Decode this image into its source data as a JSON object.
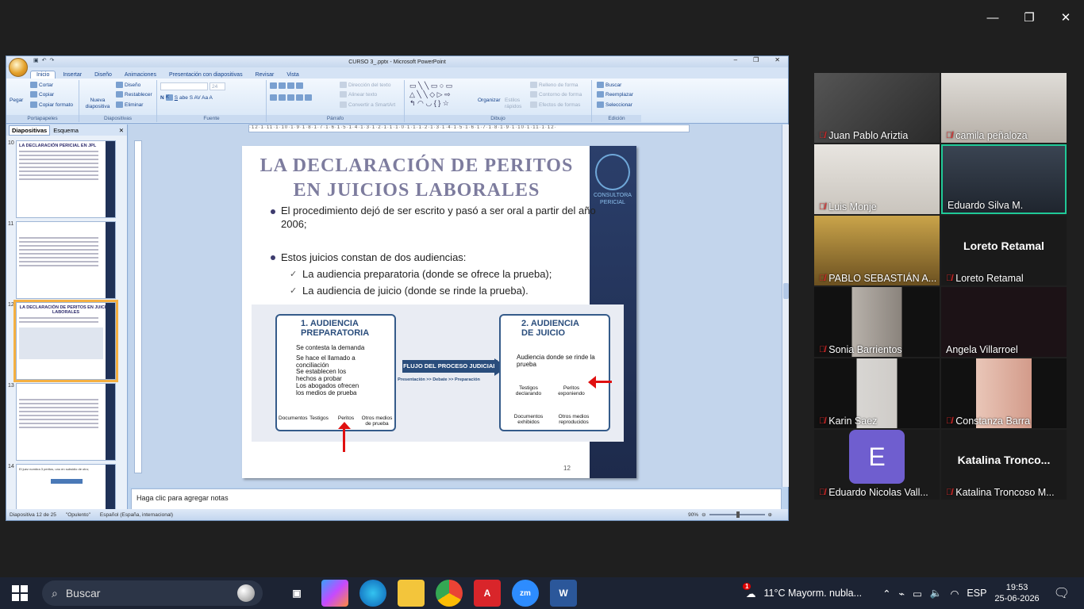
{
  "ppt": {
    "title": "CURSO 3_.pptx - Microsoft PowerPoint",
    "tabs": [
      "Inicio",
      "Insertar",
      "Diseño",
      "Animaciones",
      "Presentación con diapositivas",
      "Revisar",
      "Vista"
    ],
    "ribbon": {
      "pegar": "Pegar",
      "cortar": "Cortar",
      "copiar": "Copiar",
      "copiar_formato": "Copiar formato",
      "nueva_diapositiva": "Nueva diapositiva",
      "diseno": "Diseño",
      "restablecer": "Restablecer",
      "eliminar": "Eliminar",
      "font_size": "24",
      "direccion_texto": "Dirección del texto",
      "alinear_texto": "Alinear texto",
      "convertir_smartart": "Convertir a SmartArt",
      "organizar": "Organizar",
      "estilos_rapidos": "Estilos rápidos",
      "relleno_forma": "Relleno de forma",
      "contorno_forma": "Contorno de forma",
      "efectos_forma": "Efectos de formas",
      "buscar": "Buscar",
      "reemplazar": "Reemplazar",
      "seleccionar": "Seleccionar",
      "groups": [
        "Portapapeles",
        "Diapositivas",
        "Fuente",
        "Párrafo",
        "Dibujo",
        "Edición"
      ]
    },
    "left_tabs": [
      "Diapositivas",
      "Esquema"
    ],
    "ruler": "·12·1·11·1·10·1·9·1·8·1·7·1·6·1·5·1·4·1·3·1·2·1·1·1·0·1·1·1·2·1·3·1·4·1·5·1·6·1·7·1·8·1·9·1·10·1·11·1·12·",
    "thumbs": [
      {
        "num": "10",
        "title": "LA DECLARACIÓN PERICIAL EN JPL"
      },
      {
        "num": "11",
        "title": ""
      },
      {
        "num": "12",
        "title": "LA DECLARACIÓN DE PERITOS EN JUICIOS LABORALES"
      },
      {
        "num": "13",
        "title": ""
      },
      {
        "num": "14",
        "title": "El juez nombra 3 peritos, uno en subsidio de otro;"
      }
    ],
    "slide": {
      "title": "LA DECLARACIÓN DE PERITOS EN JUICIOS LABORALES",
      "bullet1": "El procedimiento dejó de ser escrito y pasó a ser oral a partir del año 2006;",
      "bullet2": "Estos juicios constan de dos audiencias:",
      "sub1": "La audiencia preparatoria (donde se ofrece la prueba);",
      "sub2": "La audiencia de juicio (donde se rinde la prueba).",
      "logo_text": "CONSULTORA PERICIAL",
      "number": "12",
      "infographic": {
        "card1_title": "1. AUDIENCIA PREPARATORIA",
        "card1_items": [
          "Se contesta la demanda",
          "Se hace el llamado a conciliación",
          "Se establecen los hechos a probar",
          "Los abogados ofrecen los medios de prueba"
        ],
        "card1_icons": [
          "Documentos",
          "Testigos",
          "Peritos",
          "Otros medios de prueba"
        ],
        "flow_title": "FLUJO DEL PROCESO JUDICIAL",
        "flow_steps": "Presentación >> Debate >> Preparación",
        "card2_title": "2. AUDIENCIA DE JUICIO",
        "card2_item": "Audiencia donde se rinde la prueba",
        "card2_icons": [
          "Testigos declarando",
          "Peritos exponiendo",
          "Documentos exhibidos",
          "Otros medios reproducidos"
        ]
      }
    },
    "notes_placeholder": "Haga clic para agregar notas",
    "status": {
      "slide": "Diapositiva 12 de 25",
      "theme": "\"Opulento\"",
      "lang": "Español (España, internacional)",
      "zoom": "90%"
    }
  },
  "participants": [
    {
      "name": "Juan Pablo Ariztia"
    },
    {
      "name": "camila peñaloza"
    },
    {
      "name": "Luis Monje"
    },
    {
      "name": "Eduardo Silva M."
    },
    {
      "name": "PABLO SEBASTIÁN A..."
    },
    {
      "name": "Loreto Retamal",
      "center": "Loreto Retamal"
    },
    {
      "name": "Sonia Barrientos"
    },
    {
      "name": "Angela Villarroel"
    },
    {
      "name": "Karin Saez"
    },
    {
      "name": "Constanza Barra"
    },
    {
      "name": "Eduardo Nicolas Vall...",
      "avatar": "E"
    },
    {
      "name": "Katalina Troncoso M...",
      "center": "Katalina  Tronco..."
    }
  ],
  "taskbar": {
    "search": "Buscar",
    "weather": "11°C  Mayorm. nubla...",
    "lang": "ESP",
    "time": "19:53",
    "date": "25-06-2026",
    "badge": "1"
  },
  "colors": {
    "zoom_bg": "#1f1f1f",
    "slide_title": "#7d7c9e",
    "accent": "#2a4d7c",
    "mic_muted": "#e32b2b",
    "active_speaker": "#20c997"
  }
}
